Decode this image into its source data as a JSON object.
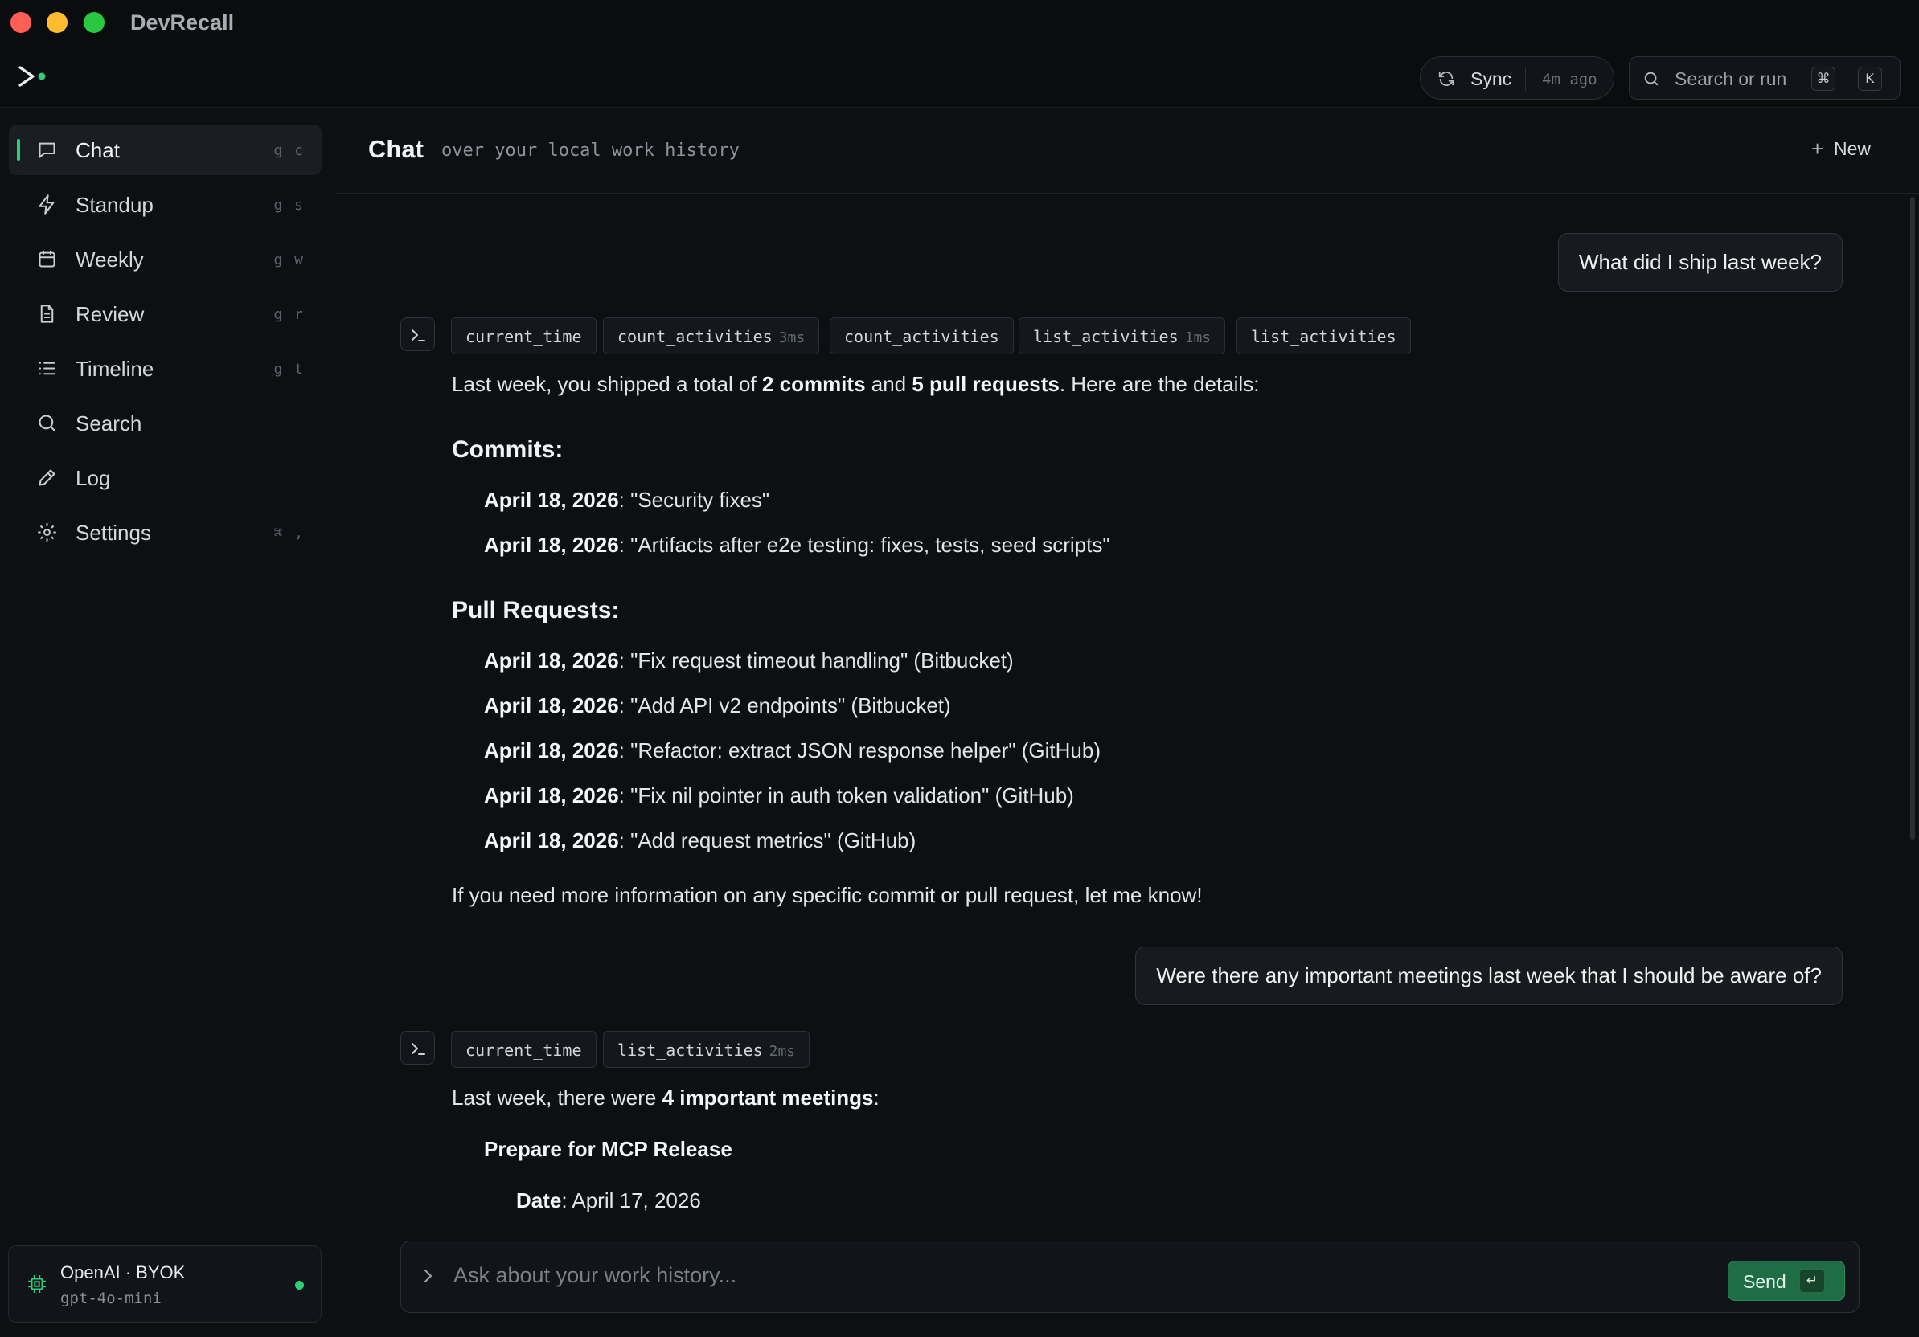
{
  "window": {
    "title": "DevRecall",
    "colors": {
      "close": "#ff5f57",
      "minimize": "#febc2e",
      "maximize": "#28c840"
    }
  },
  "topbar": {
    "sync_label": "Sync",
    "sync_ago": "4m ago",
    "search_placeholder": "Search or run",
    "search_kbd_mod": "⌘",
    "search_kbd_key": "K"
  },
  "sidebar": {
    "items": [
      {
        "label": "Chat",
        "shortcut": "g c",
        "icon": "chat-icon",
        "active": true
      },
      {
        "label": "Standup",
        "shortcut": "g s",
        "icon": "bolt-icon"
      },
      {
        "label": "Weekly",
        "shortcut": "g w",
        "icon": "calendar-icon"
      },
      {
        "label": "Review",
        "shortcut": "g r",
        "icon": "document-icon"
      },
      {
        "label": "Timeline",
        "shortcut": "g t",
        "icon": "list-icon"
      },
      {
        "label": "Search",
        "shortcut": "",
        "icon": "search-icon"
      },
      {
        "label": "Log",
        "shortcut": "",
        "icon": "pen-icon"
      },
      {
        "label": "Settings",
        "shortcut": "⌘ ,",
        "icon": "gear-icon"
      }
    ],
    "model": {
      "provider": "OpenAI · BYOK",
      "name": "gpt-4o-mini",
      "status_color": "#2fcf7a"
    }
  },
  "main": {
    "title": "Chat",
    "subtitle": "over your local work history",
    "new_label": "New"
  },
  "conversation": {
    "q1": "What did I ship last week?",
    "tools1": [
      {
        "name": "current_time",
        "time": ""
      },
      {
        "name": "count_activities",
        "time": "3ms"
      },
      {
        "name": "count_activities",
        "time": ""
      },
      {
        "name": "list_activities",
        "time": "1ms"
      },
      {
        "name": "list_activities",
        "time": ""
      }
    ],
    "a1": {
      "intro_1": "Last week, you shipped a total of ",
      "intro_commits": "2 commits",
      "intro_2": " and ",
      "intro_prs": "5 pull requests",
      "intro_3": ". Here are the details:",
      "commits_heading": "Commits:",
      "commits": [
        {
          "date": "April 18, 2026",
          "text": ": \"Security fixes\""
        },
        {
          "date": "April 18, 2026",
          "text": ": \"Artifacts after e2e testing: fixes, tests, seed scripts\""
        }
      ],
      "prs_heading": "Pull Requests:",
      "prs": [
        {
          "date": "April 18, 2026",
          "text": ": \"Fix request timeout handling\" (Bitbucket)"
        },
        {
          "date": "April 18, 2026",
          "text": ": \"Add API v2 endpoints\" (Bitbucket)"
        },
        {
          "date": "April 18, 2026",
          "text": ": \"Refactor: extract JSON response helper\" (GitHub)"
        },
        {
          "date": "April 18, 2026",
          "text": ": \"Fix nil pointer in auth token validation\" (GitHub)"
        },
        {
          "date": "April 18, 2026",
          "text": ": \"Add request metrics\" (GitHub)"
        }
      ],
      "outro": "If you need more information on any specific commit or pull request, let me know!"
    },
    "q2": "Were there any important meetings last week that I should be aware of?",
    "tools2": [
      {
        "name": "current_time",
        "time": ""
      },
      {
        "name": "list_activities",
        "time": "2ms"
      }
    ],
    "a2": {
      "intro_1": "Last week, there were ",
      "intro_bold": "4 important meetings",
      "intro_2": ":",
      "meeting_title": "Prepare for MCP Release",
      "date_label": "Date",
      "date_value": ": April 17, 2026"
    }
  },
  "composer": {
    "placeholder": "Ask about your work history...",
    "send_label": "Send",
    "send_key": "↵"
  }
}
